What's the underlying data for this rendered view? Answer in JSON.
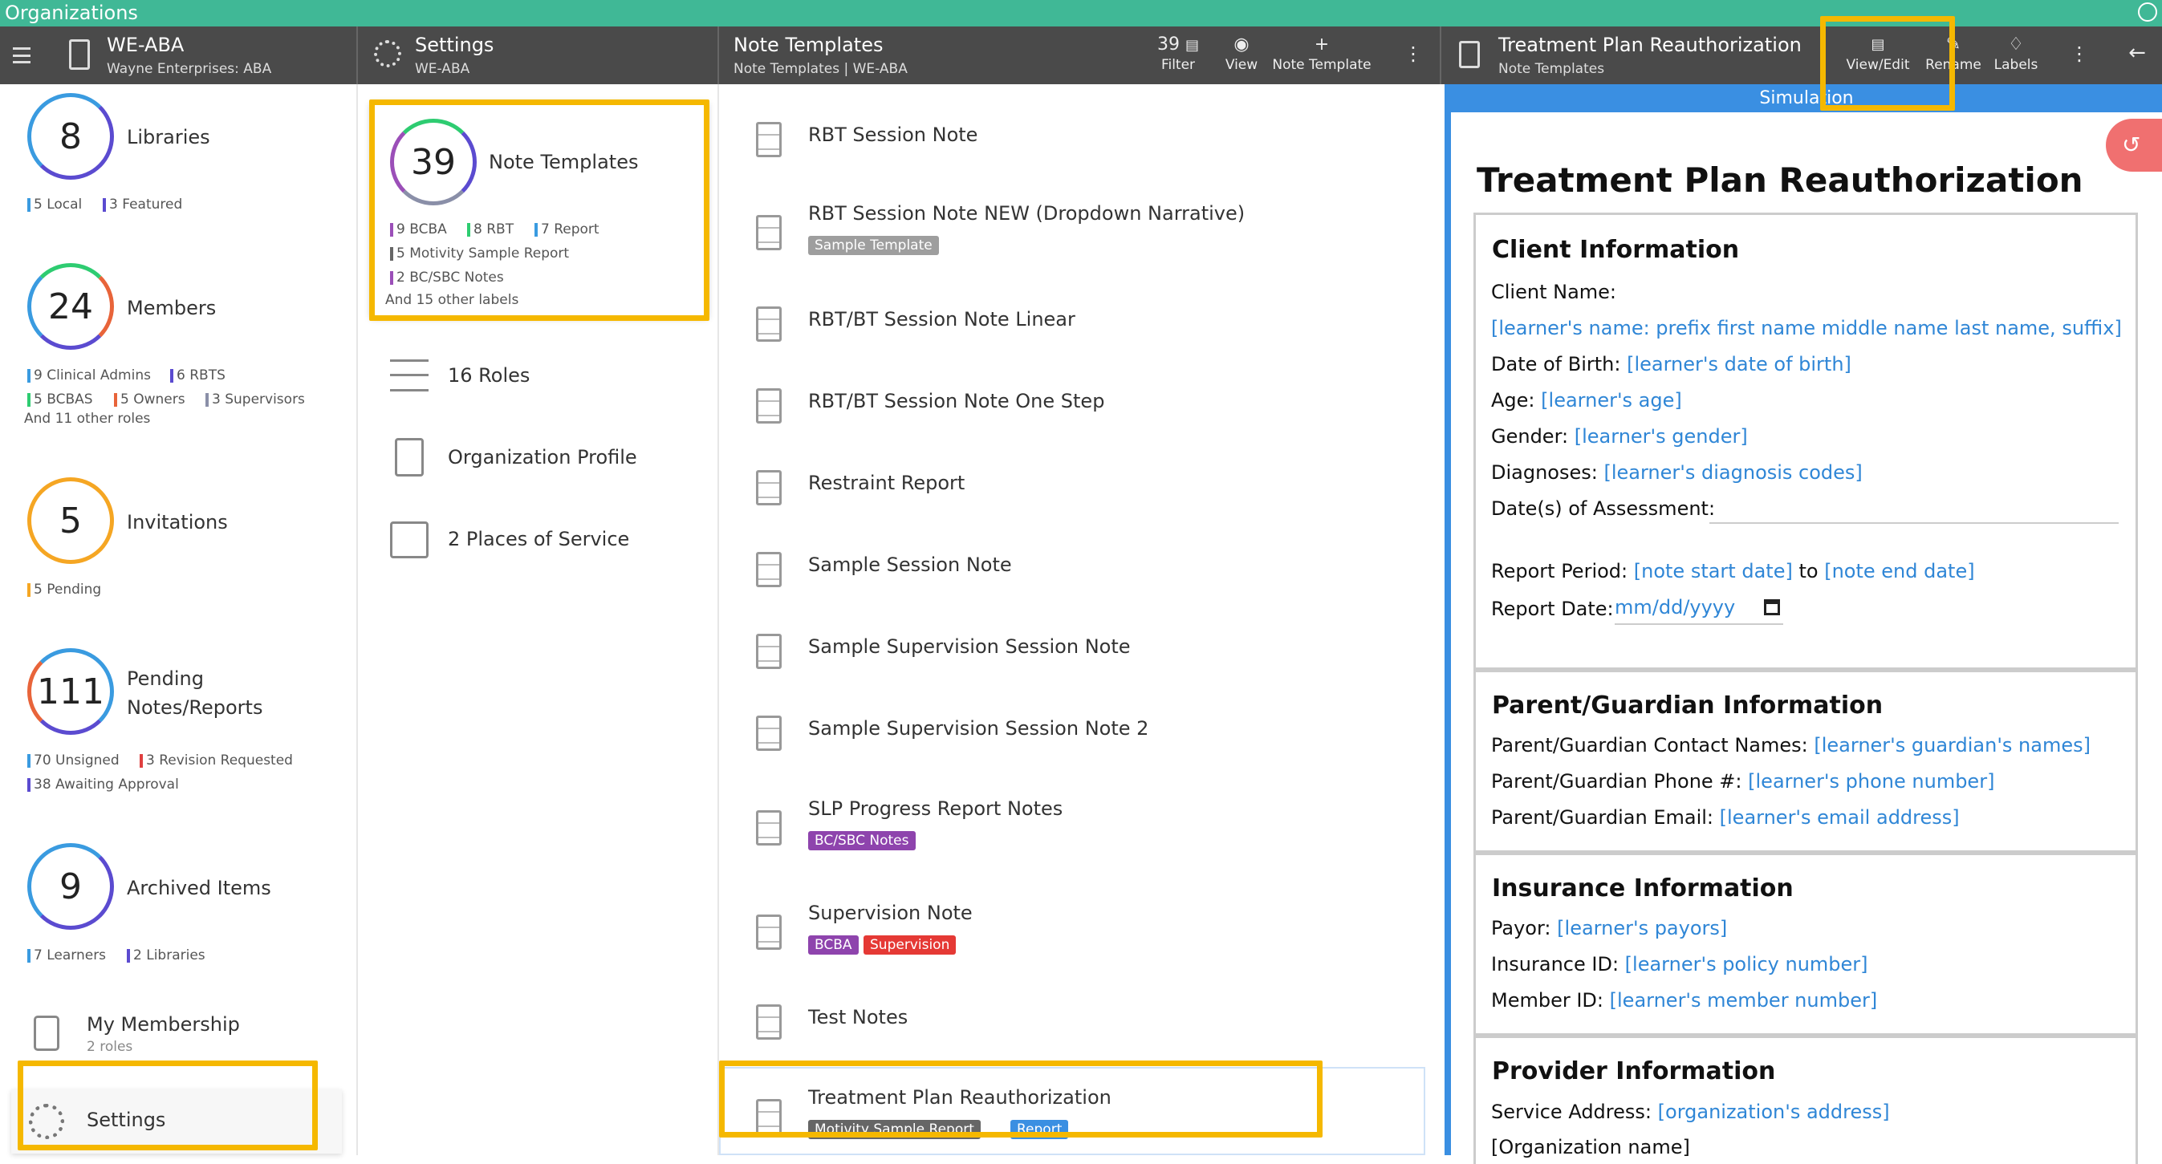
{
  "topbar": {
    "title": "Organizations"
  },
  "header": {
    "org": {
      "name": "WE-ABA",
      "subtitle": "Wayne Enterprises: ABA"
    },
    "settings": {
      "title": "Settings",
      "subtitle": "WE-ABA"
    },
    "templates": {
      "title": "Note Templates",
      "subtitle": "Note Templates | WE-ABA",
      "count": "39",
      "filter": "Filter",
      "view": "View",
      "add": "Note Template"
    },
    "doc": {
      "title": "Treatment Plan Reauthorization",
      "subtitle": "Note Templates",
      "view_edit": "View/Edit",
      "rename": "Rename",
      "labels": "Labels"
    }
  },
  "sidebar": {
    "libraries": {
      "count": "8",
      "label": "Libraries",
      "tags": [
        "5 Local",
        "3 Featured"
      ]
    },
    "members": {
      "count": "24",
      "label": "Members",
      "tags": [
        "9 Clinical Admins",
        "6 RBTS",
        "5 BCBAS",
        "5 Owners",
        "3 Supervisors"
      ],
      "more": "And 11 other roles"
    },
    "invitations": {
      "count": "5",
      "label": "Invitations",
      "tags": [
        "5 Pending"
      ]
    },
    "pending": {
      "count": "111",
      "label1": "Pending",
      "label2": "Notes/Reports",
      "tags": [
        "70 Unsigned",
        "3 Revision Requested",
        "38 Awaiting Approval"
      ]
    },
    "archived": {
      "count": "9",
      "label": "Archived Items",
      "tags": [
        "7 Learners",
        "2 Libraries"
      ]
    },
    "membership": {
      "label": "My Membership",
      "sub": "2 roles"
    },
    "settings": {
      "label": "Settings"
    }
  },
  "settings_menu": {
    "note_templates": {
      "count": "39",
      "label": "Note Templates",
      "tags": [
        "9 BCBA",
        "8 RBT",
        "7 Report",
        "5 Motivity Sample Report",
        "2 BC/SBC Notes"
      ],
      "more": "And 15 other labels"
    },
    "roles": "16 Roles",
    "org_profile": "Organization Profile",
    "places": "2 Places of Service"
  },
  "templates": [
    {
      "name": "RBT Session Note"
    },
    {
      "name": "RBT Session Note NEW (Dropdown Narrative)",
      "badges": [
        "Sample Template"
      ]
    },
    {
      "name": "RBT/BT Session Note Linear"
    },
    {
      "name": "RBT/BT Session Note One Step"
    },
    {
      "name": "Restraint Report"
    },
    {
      "name": "Sample Session Note"
    },
    {
      "name": "Sample Supervision Session Note"
    },
    {
      "name": "Sample Supervision Session Note 2"
    },
    {
      "name": "SLP Progress Report Notes",
      "badges": [
        "BC/SBC Notes"
      ]
    },
    {
      "name": "Supervision Note",
      "badges": [
        "BCBA",
        "Supervision"
      ]
    },
    {
      "name": "Test Notes"
    },
    {
      "name": "Treatment Plan Reauthorization",
      "badges": [
        "Motivity Sample Report",
        "Report"
      ]
    }
  ],
  "document": {
    "banner": "Simulation",
    "title": "Treatment Plan Reauthorization",
    "client": {
      "heading": "Client Information",
      "name_label": "Client Name:",
      "name_value": "[learner's name: prefix first name middle name last name, suffix]",
      "dob_label": "Date of Birth:",
      "dob_value": "[learner's date of birth]",
      "age_label": "Age:",
      "age_value": "[learner's age]",
      "gender_label": "Gender:",
      "gender_value": "[learner's gender]",
      "diag_label": "Diagnoses:",
      "diag_value": "[learner's diagnosis codes]",
      "assess_label": "Date(s) of Assessment:",
      "period_label": "Report Period:",
      "period_start": "[note start date]",
      "period_to": "to",
      "period_end": "[note end date]",
      "report_date_label": "Report Date:",
      "report_date_placeholder": "mm/dd/yyyy"
    },
    "guardian": {
      "heading": "Parent/Guardian Information",
      "names_label": "Parent/Guardian Contact Names:",
      "names_value": "[learner's guardian's names]",
      "phone_label": "Parent/Guardian Phone #:",
      "phone_value": "[learner's phone number]",
      "email_label": "Parent/Guardian Email:",
      "email_value": "[learner's email address]"
    },
    "insurance": {
      "heading": "Insurance Information",
      "payor_label": "Payor:",
      "payor_value": "[learner's payors]",
      "ins_label": "Insurance ID:",
      "ins_value": "[learner's policy number]",
      "member_label": "Member ID:",
      "member_value": "[learner's member number]"
    },
    "provider": {
      "heading": "Provider Information",
      "addr_label": "Service Address:",
      "addr_value": "[organization's address]",
      "org_name": "[Organization name]"
    }
  },
  "colors": {
    "accent": "#40b896",
    "header": "#4a4a4a",
    "highlight": "#f5b800",
    "link": "#2f86d6",
    "doc_border": "#3a8fe2"
  }
}
